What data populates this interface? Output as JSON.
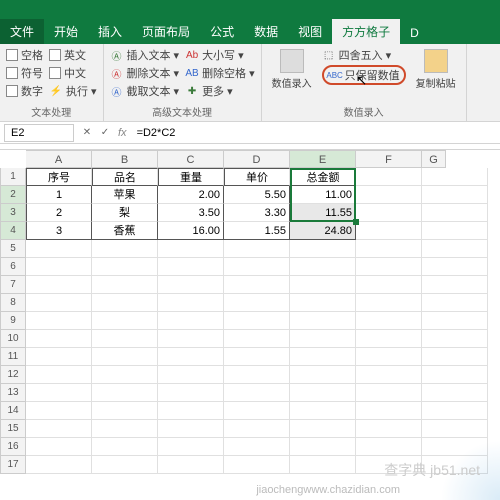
{
  "tabs": {
    "file": "文件",
    "t0": "开始",
    "t1": "插入",
    "t2": "页面布局",
    "t3": "公式",
    "t4": "数据",
    "t5": "视图",
    "active": "方方格子",
    "extra": "D"
  },
  "ribbon": {
    "g1": {
      "label": "文本处理",
      "i0": "空格",
      "i1": "英文",
      "i2": "符号",
      "i3": "中文",
      "i4": "数字",
      "i5": "执行"
    },
    "g2": {
      "label": "高级文本处理",
      "i0": "插入文本",
      "i1": "删除文本",
      "i2": "截取文本",
      "i3": "大小写",
      "i4": "删除空格",
      "i5": "更多"
    },
    "g3": {
      "label": "数值录入",
      "i0": "数值录入",
      "i1": "四舍五入",
      "i2": "只保留数值",
      "i3": "复制粘贴"
    }
  },
  "formulabar": {
    "name": "E2",
    "fx": "fx",
    "formula": "=D2*C2"
  },
  "cols": [
    "A",
    "B",
    "C",
    "D",
    "E",
    "F",
    "G"
  ],
  "headers": {
    "c0": "序号",
    "c1": "品名",
    "c2": "重量",
    "c3": "单价",
    "c4": "总金额"
  },
  "rows": [
    {
      "n": "1",
      "c0": "1",
      "c1": "苹果",
      "c2": "2.00",
      "c3": "5.50",
      "c4": "11.00"
    },
    {
      "n": "2",
      "c0": "2",
      "c1": "梨",
      "c2": "3.50",
      "c3": "3.30",
      "c4": "11.55"
    },
    {
      "n": "3",
      "c0": "3",
      "c1": "香蕉",
      "c2": "16.00",
      "c3": "1.55",
      "c4": "24.80"
    }
  ],
  "emptyRows": [
    "5",
    "6",
    "7",
    "8",
    "9",
    "10",
    "11",
    "12",
    "13",
    "14",
    "15",
    "16",
    "17"
  ],
  "watermark": "查字典 jb51.net",
  "watermark2": "jiaochengwww.chazidian.com",
  "chart_data": {
    "type": "table",
    "title": "",
    "columns": [
      "序号",
      "品名",
      "重量",
      "单价",
      "总金额"
    ],
    "rows": [
      [
        1,
        "苹果",
        2.0,
        5.5,
        11.0
      ],
      [
        2,
        "梨",
        3.5,
        3.3,
        11.55
      ],
      [
        3,
        "香蕉",
        16.0,
        1.55,
        24.8
      ]
    ],
    "active_cell": "E2",
    "formula": "=D2*C2",
    "selection": "E2:E4"
  }
}
